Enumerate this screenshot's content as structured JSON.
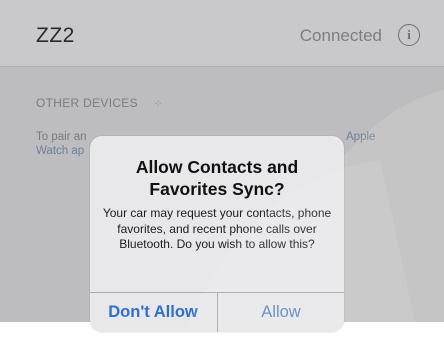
{
  "device": {
    "name": "ZZ2",
    "status": "Connected",
    "info_glyph": "i"
  },
  "other_devices": {
    "header": "OTHER DEVICES",
    "spinner_glyph": "⁘",
    "pair_line1": "To pair an",
    "pair_line2": "Watch ap",
    "pair_link": "Apple"
  },
  "alert": {
    "title": "Allow Contacts and Favorites Sync?",
    "message": "Your car may request your contacts, phone favorites, and recent phone calls over Bluetooth. Do you wish to allow this?",
    "dont_allow_label": "Don't Allow",
    "allow_label": "Allow"
  },
  "colors": {
    "accent": "#2e6fd0",
    "dim_background": "#bdbdbf",
    "alert_background": "#e8e8ea"
  }
}
